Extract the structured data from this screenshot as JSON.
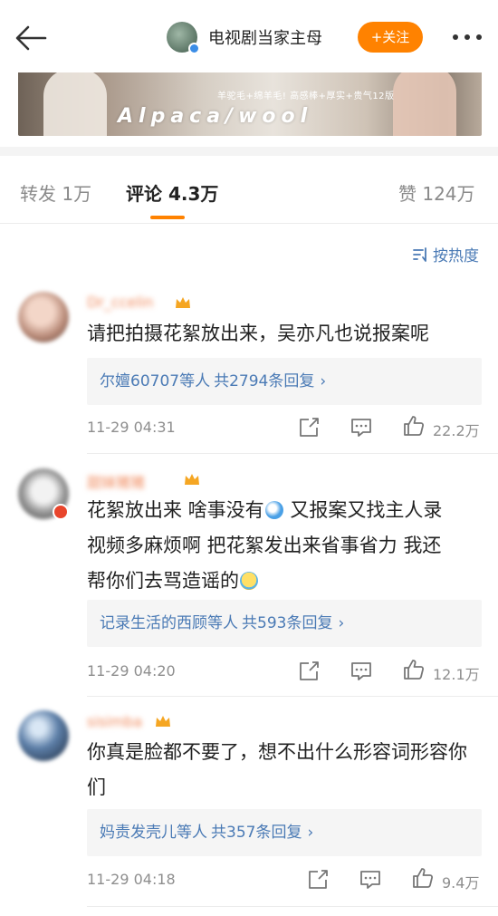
{
  "header": {
    "account_name": "电视剧当家主母",
    "follow_label": "+关注"
  },
  "banner": {
    "subtitle": "羊驼毛+绵羊毛! 高感棒+厚实+贵气12版",
    "english_text": "Alpaca/wool"
  },
  "tabs": [
    {
      "label": "转发 1万"
    },
    {
      "label": "评论 4.3万"
    },
    {
      "label": "赞 124万"
    }
  ],
  "sort_label": "按热度",
  "comments": [
    {
      "username": "Dr_ccelin",
      "text": "请把拍摄花絮放出来，吴亦凡也说报案呢",
      "replies_who": "尔嬗60707等人",
      "replies_count": "共2794条回复",
      "time": "11-29 04:31",
      "likes": "22.2万"
    },
    {
      "username": "甜妹猪猪",
      "text_1": "花絮放出来 啥事没有",
      "text_2": " 又报案又找主人录",
      "text_3": "视频多麻烦啊 把花絮发出来省事省力 我还",
      "text_4": "帮你们去骂造谣的",
      "replies_who": "记录生活的西顾等人",
      "replies_count": "共593条回复",
      "time": "11-29 04:20",
      "likes": "12.1万"
    },
    {
      "username": "sisimba",
      "text": "你真是脸都不要了，想不出什么形容词形容你们",
      "replies_who": "妈责发壳儿等人",
      "replies_count": "共357条回复",
      "time": "11-29 04:18",
      "likes": "9.4万"
    }
  ],
  "colors": {
    "accent": "#ff8200",
    "link": "#4a7ab5",
    "username": "#f08a5d",
    "muted": "#8e8e8e"
  },
  "icons": [
    "back-arrow-icon",
    "verified-badge-icon",
    "more-dots-icon",
    "sort-icon",
    "share-icon",
    "comment-icon",
    "like-icon",
    "crown-icon",
    "chevron-right-icon",
    "emoji-icon"
  ]
}
